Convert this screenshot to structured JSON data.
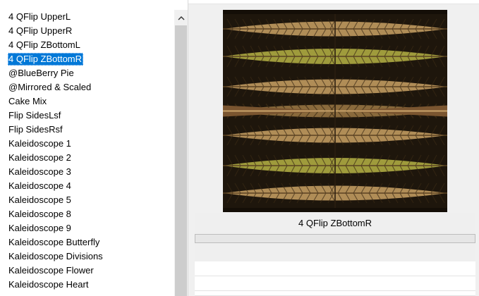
{
  "filter_list": {
    "items": [
      {
        "label": "4 QFlip UpperL",
        "selected": false
      },
      {
        "label": "4 QFlip UpperR",
        "selected": false
      },
      {
        "label": "4 QFlip ZBottomL",
        "selected": false
      },
      {
        "label": "4 QFlip ZBottomR",
        "selected": true
      },
      {
        "label": "@BlueBerry Pie",
        "selected": false
      },
      {
        "label": "@Mirrored & Scaled",
        "selected": false
      },
      {
        "label": "Cake Mix",
        "selected": false
      },
      {
        "label": "Flip SidesLsf",
        "selected": false
      },
      {
        "label": "Flip SidesRsf",
        "selected": false
      },
      {
        "label": "Kaleidoscope 1",
        "selected": false
      },
      {
        "label": "Kaleidoscope 2",
        "selected": false
      },
      {
        "label": "Kaleidoscope 3",
        "selected": false
      },
      {
        "label": "Kaleidoscope 4",
        "selected": false
      },
      {
        "label": "Kaleidoscope 5",
        "selected": false
      },
      {
        "label": "Kaleidoscope 8",
        "selected": false
      },
      {
        "label": "Kaleidoscope 9",
        "selected": false
      },
      {
        "label": "Kaleidoscope Butterfly",
        "selected": false
      },
      {
        "label": "Kaleidoscope Divisions",
        "selected": false
      },
      {
        "label": "Kaleidoscope Flower",
        "selected": false
      },
      {
        "label": "Kaleidoscope Heart",
        "selected": false
      }
    ]
  },
  "preview": {
    "caption": "4 QFlip ZBottomR",
    "progress_percent": 0
  },
  "icons": {
    "scroll_up": "chevron-up-icon"
  },
  "colors": {
    "selection": "#0078d7",
    "leaf_dark": "#2a1f12",
    "leaf_tan": "#b8935c",
    "leaf_olive": "#a7a23f"
  }
}
